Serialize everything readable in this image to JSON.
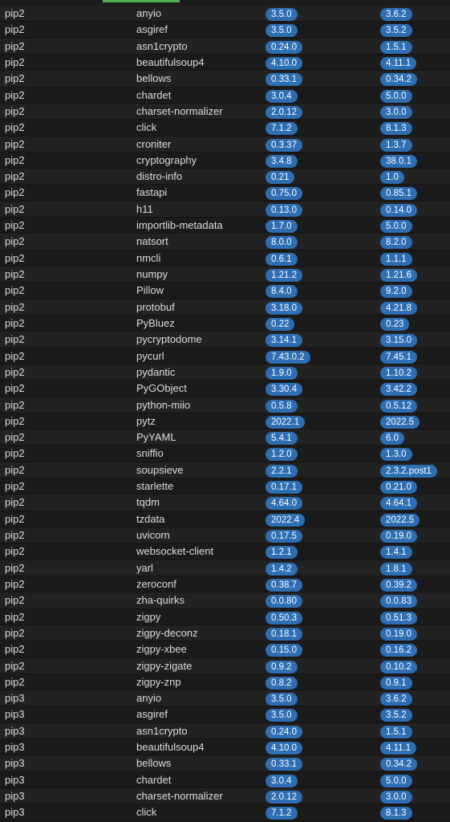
{
  "rows": [
    {
      "source": "pip2",
      "package": "anyio",
      "current": "3.5.0",
      "latest": "3.6.2"
    },
    {
      "source": "pip2",
      "package": "asgiref",
      "current": "3.5.0",
      "latest": "3.5.2"
    },
    {
      "source": "pip2",
      "package": "asn1crypto",
      "current": "0.24.0",
      "latest": "1.5.1"
    },
    {
      "source": "pip2",
      "package": "beautifulsoup4",
      "current": "4.10.0",
      "latest": "4.11.1"
    },
    {
      "source": "pip2",
      "package": "bellows",
      "current": "0.33.1",
      "latest": "0.34.2"
    },
    {
      "source": "pip2",
      "package": "chardet",
      "current": "3.0.4",
      "latest": "5.0.0"
    },
    {
      "source": "pip2",
      "package": "charset-normalizer",
      "current": "2.0.12",
      "latest": "3.0.0"
    },
    {
      "source": "pip2",
      "package": "click",
      "current": "7.1.2",
      "latest": "8.1.3"
    },
    {
      "source": "pip2",
      "package": "croniter",
      "current": "0.3.37",
      "latest": "1.3.7"
    },
    {
      "source": "pip2",
      "package": "cryptography",
      "current": "3.4.8",
      "latest": "38.0.1"
    },
    {
      "source": "pip2",
      "package": "distro-info",
      "current": "0.21",
      "latest": "1.0"
    },
    {
      "source": "pip2",
      "package": "fastapi",
      "current": "0.75.0",
      "latest": "0.85.1"
    },
    {
      "source": "pip2",
      "package": "h11",
      "current": "0.13.0",
      "latest": "0.14.0"
    },
    {
      "source": "pip2",
      "package": "importlib-metadata",
      "current": "1.7.0",
      "latest": "5.0.0"
    },
    {
      "source": "pip2",
      "package": "natsort",
      "current": "8.0.0",
      "latest": "8.2.0"
    },
    {
      "source": "pip2",
      "package": "nmcli",
      "current": "0.6.1",
      "latest": "1.1.1"
    },
    {
      "source": "pip2",
      "package": "numpy",
      "current": "1.21.2",
      "latest": "1.21.6"
    },
    {
      "source": "pip2",
      "package": "Pillow",
      "current": "8.4.0",
      "latest": "9.2.0"
    },
    {
      "source": "pip2",
      "package": "protobuf",
      "current": "3.18.0",
      "latest": "4.21.8"
    },
    {
      "source": "pip2",
      "package": "PyBluez",
      "current": "0.22",
      "latest": "0.23"
    },
    {
      "source": "pip2",
      "package": "pycryptodome",
      "current": "3.14.1",
      "latest": "3.15.0"
    },
    {
      "source": "pip2",
      "package": "pycurl",
      "current": "7.43.0.2",
      "latest": "7.45.1"
    },
    {
      "source": "pip2",
      "package": "pydantic",
      "current": "1.9.0",
      "latest": "1.10.2"
    },
    {
      "source": "pip2",
      "package": "PyGObject",
      "current": "3.30.4",
      "latest": "3.42.2"
    },
    {
      "source": "pip2",
      "package": "python-miio",
      "current": "0.5.8",
      "latest": "0.5.12"
    },
    {
      "source": "pip2",
      "package": "pytz",
      "current": "2022.1",
      "latest": "2022.5"
    },
    {
      "source": "pip2",
      "package": "PyYAML",
      "current": "5.4.1",
      "latest": "6.0"
    },
    {
      "source": "pip2",
      "package": "sniffio",
      "current": "1.2.0",
      "latest": "1.3.0"
    },
    {
      "source": "pip2",
      "package": "soupsieve",
      "current": "2.2.1",
      "latest": "2.3.2.post1"
    },
    {
      "source": "pip2",
      "package": "starlette",
      "current": "0.17.1",
      "latest": "0.21.0"
    },
    {
      "source": "pip2",
      "package": "tqdm",
      "current": "4.64.0",
      "latest": "4.64.1"
    },
    {
      "source": "pip2",
      "package": "tzdata",
      "current": "2022.4",
      "latest": "2022.5"
    },
    {
      "source": "pip2",
      "package": "uvicorn",
      "current": "0.17.5",
      "latest": "0.19.0"
    },
    {
      "source": "pip2",
      "package": "websocket-client",
      "current": "1.2.1",
      "latest": "1.4.1"
    },
    {
      "source": "pip2",
      "package": "yarl",
      "current": "1.4.2",
      "latest": "1.8.1"
    },
    {
      "source": "pip2",
      "package": "zeroconf",
      "current": "0.38.7",
      "latest": "0.39.2"
    },
    {
      "source": "pip2",
      "package": "zha-quirks",
      "current": "0.0.80",
      "latest": "0.0.83"
    },
    {
      "source": "pip2",
      "package": "zigpy",
      "current": "0.50.3",
      "latest": "0.51.3"
    },
    {
      "source": "pip2",
      "package": "zigpy-deconz",
      "current": "0.18.1",
      "latest": "0.19.0"
    },
    {
      "source": "pip2",
      "package": "zigpy-xbee",
      "current": "0.15.0",
      "latest": "0.16.2"
    },
    {
      "source": "pip2",
      "package": "zigpy-zigate",
      "current": "0.9.2",
      "latest": "0.10.2"
    },
    {
      "source": "pip2",
      "package": "zigpy-znp",
      "current": "0.8.2",
      "latest": "0.9.1"
    },
    {
      "source": "pip3",
      "package": "anyio",
      "current": "3.5.0",
      "latest": "3.6.2"
    },
    {
      "source": "pip3",
      "package": "asgiref",
      "current": "3.5.0",
      "latest": "3.5.2"
    },
    {
      "source": "pip3",
      "package": "asn1crypto",
      "current": "0.24.0",
      "latest": "1.5.1"
    },
    {
      "source": "pip3",
      "package": "beautifulsoup4",
      "current": "4.10.0",
      "latest": "4.11.1"
    },
    {
      "source": "pip3",
      "package": "bellows",
      "current": "0.33.1",
      "latest": "0.34.2"
    },
    {
      "source": "pip3",
      "package": "chardet",
      "current": "3.0.4",
      "latest": "5.0.0"
    },
    {
      "source": "pip3",
      "package": "charset-normalizer",
      "current": "2.0.12",
      "latest": "3.0.0"
    },
    {
      "source": "pip3",
      "package": "click",
      "current": "7.1.2",
      "latest": "8.1.3"
    }
  ],
  "colors": {
    "badge": "#2e6eb3",
    "accent": "#4caf50",
    "background": "#1c1c1c"
  }
}
